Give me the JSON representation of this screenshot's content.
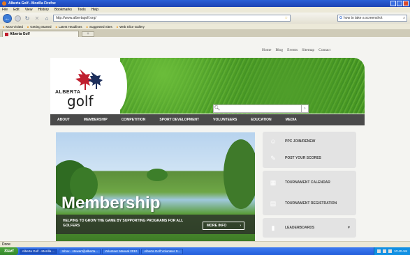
{
  "window": {
    "title": "Alberta Golf - Mozilla Firefox"
  },
  "menu": [
    "File",
    "Edit",
    "View",
    "History",
    "Bookmarks",
    "Tools",
    "Help"
  ],
  "nav": {
    "url": "http://www.albertagolf.org/",
    "search_value": "how to take a screenshot"
  },
  "bookmarks": [
    "Most Visited",
    "Getting Started",
    "Latest Headlines",
    "Suggested Sites",
    "Web Slice Gallery"
  ],
  "tab": {
    "title": "Alberta Golf",
    "new_tab": "+"
  },
  "site": {
    "toplinks": [
      "Home",
      "Blog",
      "Events",
      "Sitemap",
      "Contact"
    ],
    "brand_top": "ALBERTA",
    "brand_bottom": "golf",
    "mainnav": [
      "ABOUT",
      "MEMBERSHIP",
      "COMPETITION",
      "SPORT DEVELOPMENT",
      "VOLUNTEERS",
      "EDUCATION",
      "MEDIA"
    ],
    "hero": {
      "title": "Membership",
      "subtitle": "HELPING TO GROW THE GAME BY SUPPORTING PROGRAMS FOR ALL GOLFERS",
      "button": "MORE INFO"
    },
    "side": {
      "group1": [
        "PPC JOIN/RENEW",
        "POST YOUR SCORES"
      ],
      "group2": [
        "TOURNAMENT CALENDAR",
        "TOURNAMENT REGISTRATION"
      ],
      "group3": [
        "LEADERBOARDS"
      ]
    }
  },
  "status": {
    "text": "Done"
  },
  "taskbar": {
    "start": "Start",
    "tasks": [
      "Alberta Golf - Mozilla ...",
      "Inbox - stewart@alberta...",
      "Volunteer Manual 2010",
      "Alberta Golf Volunteer S..."
    ],
    "clock": "10:40 AM"
  },
  "colors": {
    "brand_red": "#c01e2e",
    "nav_bg": "#4a4a4a",
    "grass": "#4f9e2a"
  }
}
